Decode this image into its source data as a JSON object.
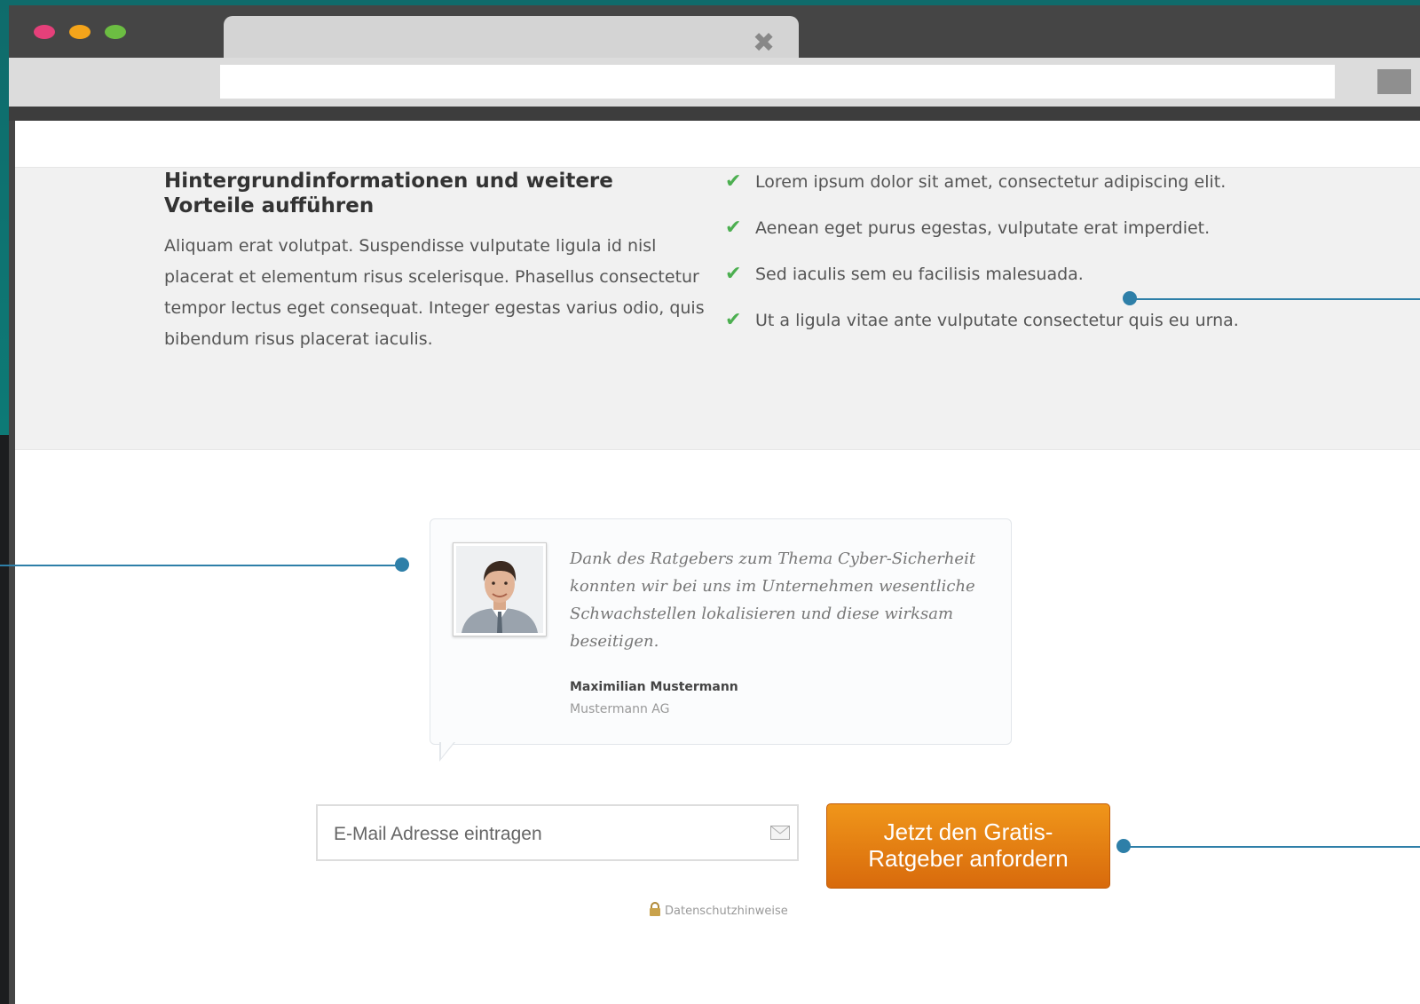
{
  "browser": {
    "traffic_lights": {
      "close": "#e5407a",
      "minimize": "#f4a41a",
      "maximize": "#6cbd42"
    },
    "tab_close_icon": "close-icon"
  },
  "benefits_section": {
    "heading": "Hintergrundinformationen und weitere Vorteile aufführen",
    "paragraph": "Aliquam erat volutpat. Suspendisse vulputate ligula id nisl placerat et elementum risus scelerisque. Phasellus consectetur tempor lectus eget consequat. Integer egestas varius odio, quis bibendum risus placerat iaculis.",
    "items": [
      {
        "label": "Lorem ipsum dolor sit amet, consectetur adipiscing elit."
      },
      {
        "label": "Aenean eget purus egestas, vulputate erat imperdiet."
      },
      {
        "label": "Sed iaculis sem eu facilisis malesuada."
      },
      {
        "label": "Ut a ligula vitae ante vulputate consectetur quis eu urna."
      }
    ]
  },
  "testimonial": {
    "quote": "Dank des Ratgebers zum Thema Cyber-Sicherheit konnten wir bei uns im Unternehmen wesentliche Schwachstellen lokalisieren und diese wirksam beseitigen.",
    "author": "Maximilian Mustermann",
    "company": "Mustermann AG"
  },
  "signup": {
    "email_placeholder": "E-Mail Adresse eintragen",
    "cta_line1": "Jetzt den Gratis-",
    "cta_line2": "Ratgeber anfordern",
    "privacy_label": "Datenschutzhinweise"
  },
  "colors": {
    "accent": "#2e7fa8",
    "check": "#4caf50",
    "cta_top": "#f0961a",
    "cta_bottom": "#d86a0c"
  }
}
